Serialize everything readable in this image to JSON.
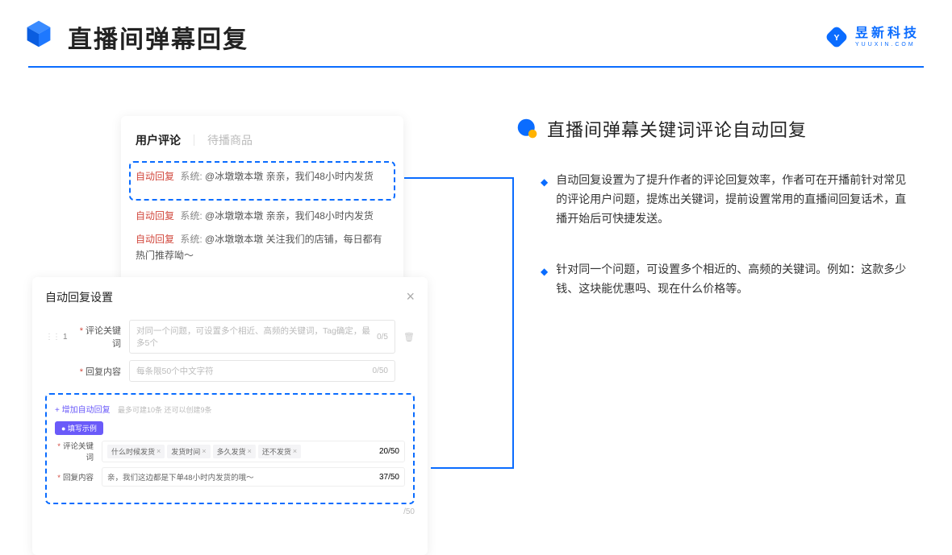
{
  "header": {
    "title": "直播间弹幕回复",
    "brand_name": "昱新科技",
    "brand_sub": "YUUXIN.COM"
  },
  "comments": {
    "tab_active": "用户评论",
    "tab_inactive": "待播商品",
    "c1_tag": "自动回复",
    "c1_sys": "系统:",
    "c1_text": "@冰墩墩本墩 亲亲，我们48小时内发货",
    "c2_tag": "自动回复",
    "c2_sys": "系统:",
    "c2_text": "@冰墩墩本墩 亲亲，我们48小时内发货",
    "c3_tag": "自动回复",
    "c3_sys": "系统:",
    "c3_text": "@冰墩墩本墩 关注我们的店铺，每日都有热门推荐呦～"
  },
  "settings": {
    "title": "自动回复设置",
    "row_num": "1",
    "label_keyword": "评论关键词",
    "keyword_placeholder": "对同一个问题，可设置多个相近、高频的关键词，Tag确定，最多5个",
    "keyword_count": "0/5",
    "label_content": "回复内容",
    "content_placeholder": "每条限50个中文字符",
    "content_count": "0/50",
    "add_link": "+ 增加自动回复",
    "add_sub": "最多可建10条 还可以创建9条",
    "example_pill": "● 填写示例",
    "ex_label_keyword": "评论关键词",
    "ex_tags": [
      "什么时候发货",
      "发货时间",
      "多久发货",
      "还不发货"
    ],
    "ex_kw_count": "20/50",
    "ex_label_content": "回复内容",
    "ex_content": "亲，我们这边都是下单48小时内发货的哦～",
    "ex_content_count": "37/50",
    "outer_count": "/50"
  },
  "right": {
    "section_title": "直播间弹幕关键词评论自动回复",
    "bullet1": "自动回复设置为了提升作者的评论回复效率，作者可在开播前针对常见的评论用户问题，提炼出关键词，提前设置常用的直播间回复话术，直播开始后可快捷发送。",
    "bullet2": "针对同一个问题，可设置多个相近的、高频的关键词。例如：这款多少钱、这块能优惠吗、现在什么价格等。"
  }
}
